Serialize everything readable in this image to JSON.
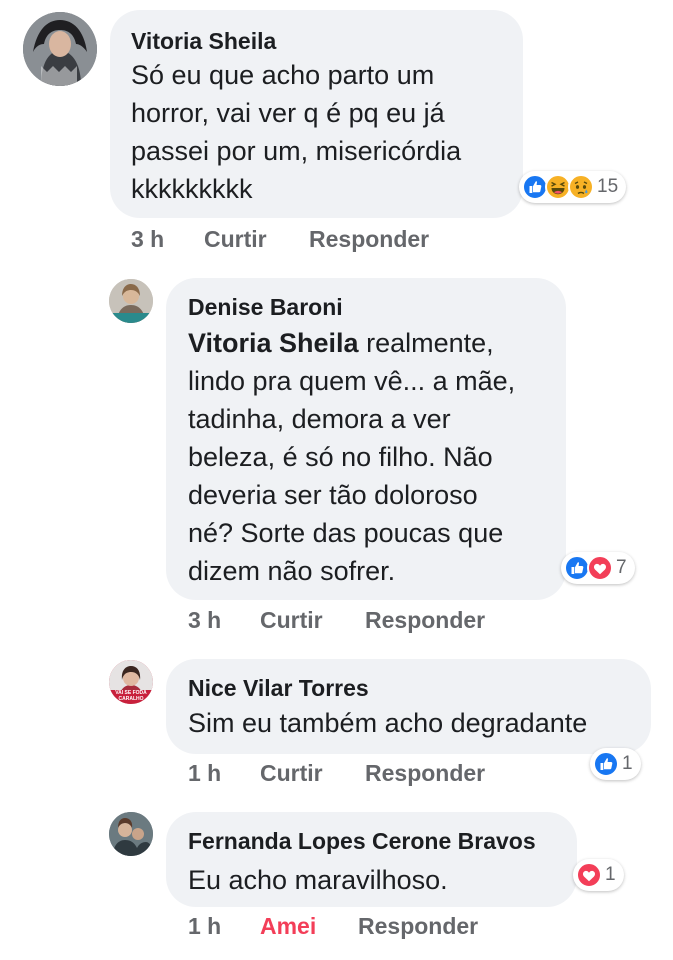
{
  "colors": {
    "bubble_bg": "#f0f2f5",
    "meta_text": "#65676b",
    "like_blue": "#1877f2",
    "love_red": "#f33e58",
    "haha_yellow": "#f7b125"
  },
  "comments": [
    {
      "author": "Vitoria Sheila",
      "mention": "",
      "lines": [
        "Só eu que acho parto um",
        "horror, vai ver q é pq eu já",
        "passei por um, misericórdia",
        "kkkkkkkkk"
      ],
      "time": "3 h",
      "like_label": "Curtir",
      "reply_label": "Responder",
      "reactions": [
        "like-icon",
        "haha-icon",
        "sad-icon"
      ],
      "reaction_count": "15"
    },
    {
      "author": "Denise Baroni",
      "mention": "Vitoria Sheila",
      "first_line_rest": " realmente,",
      "lines": [
        "lindo pra quem vê... a mãe,",
        "tadinha, demora a ver",
        "beleza, é só no filho. Não",
        "deveria ser tão doloroso",
        "né? Sorte das poucas que",
        "dizem não sofrer."
      ],
      "time": "3 h",
      "like_label": "Curtir",
      "reply_label": "Responder",
      "reactions": [
        "like-icon",
        "love-icon"
      ],
      "reaction_count": "7"
    },
    {
      "author": "Nice Vilar Torres",
      "avatar_text": [
        "VAI SE FODA",
        "CARALHO"
      ],
      "lines": [
        "Sim eu também acho degradante"
      ],
      "time": "1 h",
      "like_label": "Curtir",
      "reply_label": "Responder",
      "reactions": [
        "like-icon"
      ],
      "reaction_count": "1"
    },
    {
      "author": "Fernanda Lopes Cerone Bravos",
      "lines": [
        "Eu acho maravilhoso."
      ],
      "time": "1 h",
      "like_label": "Amei",
      "reply_label": "Responder",
      "reactions": [
        "love-icon"
      ],
      "reaction_count": "1"
    }
  ]
}
